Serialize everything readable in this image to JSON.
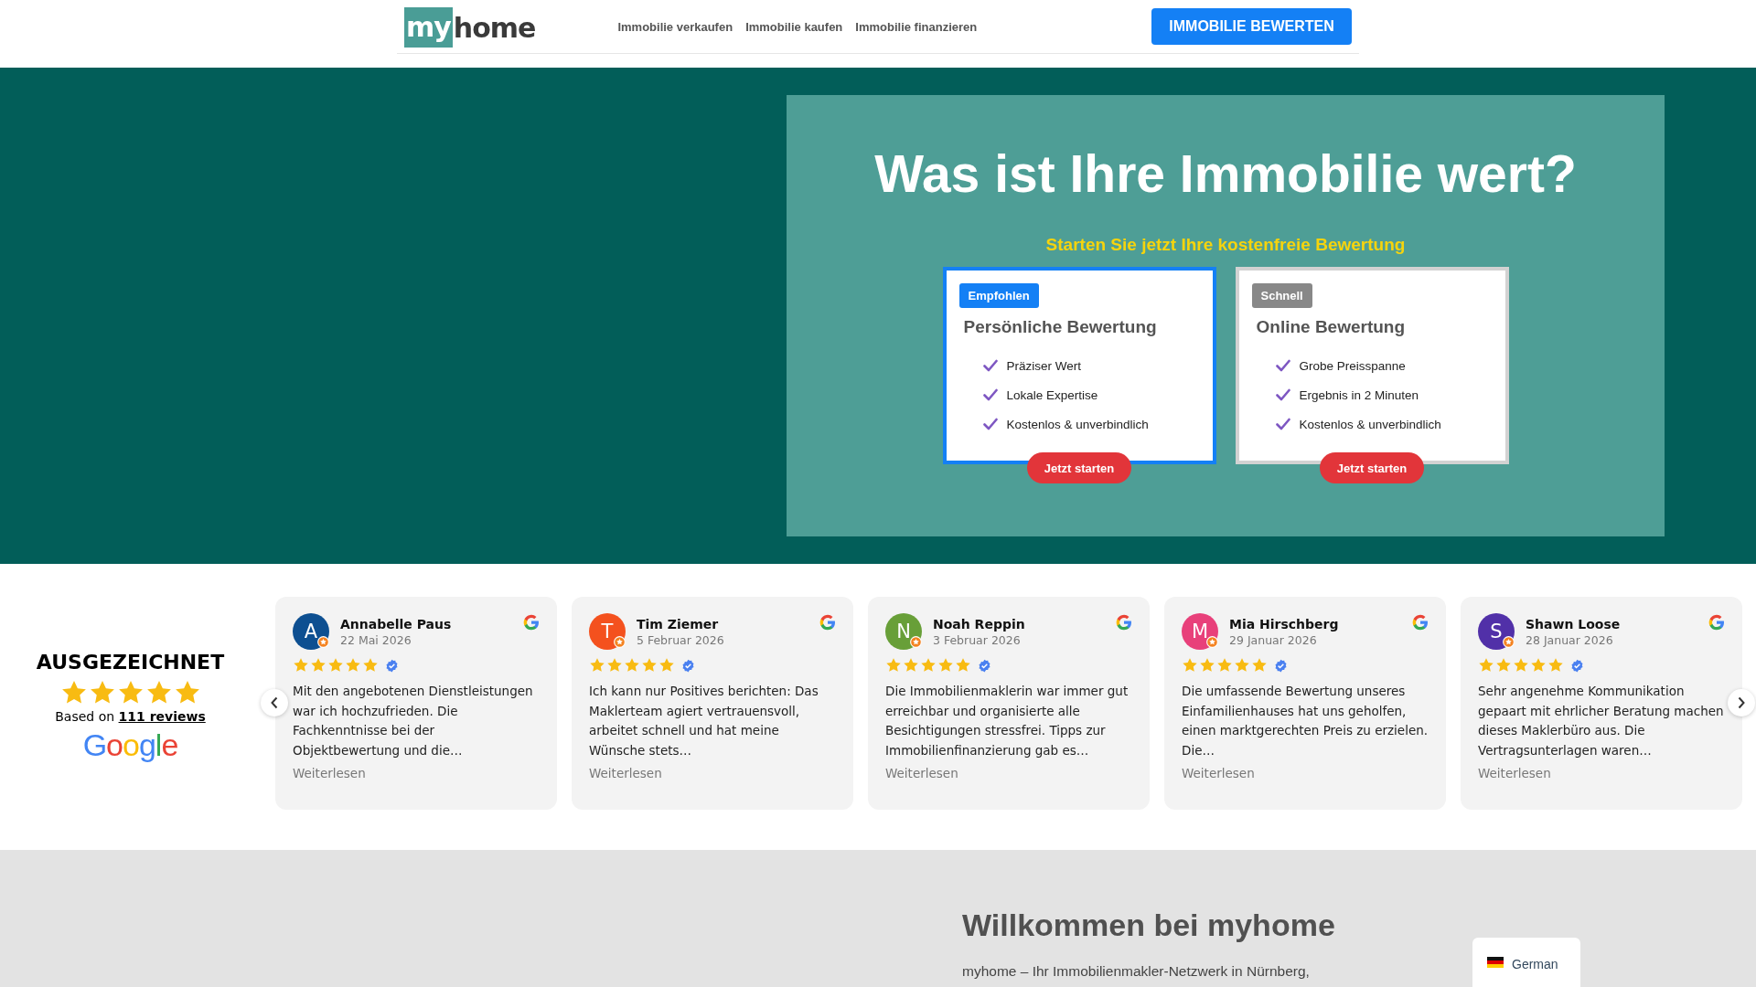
{
  "header": {
    "logo": {
      "boxed": "my",
      "rest": "home"
    },
    "nav": [
      "Immobilie verkaufen",
      "Immobilie kaufen",
      "Immobilie finanzieren"
    ],
    "cta": "IMMOBILIE BEWERTEN"
  },
  "hero": {
    "title": "Was ist Ihre Immobilie wert?",
    "subtitle": "Starten Sie jetzt Ihre kostenfreie Bewertung",
    "options": [
      {
        "badge": "Empfohlen",
        "featured": true,
        "title": "Persönliche Bewertung",
        "features": [
          "Präziser Wert",
          "Lokale Expertise",
          "Kostenlos & unverbindlich"
        ],
        "button": "Jetzt starten"
      },
      {
        "badge": "Schnell",
        "featured": false,
        "title": "Online Bewertung",
        "features": [
          "Grobe Preisspanne",
          "Ergebnis in 2 Minuten",
          "Kostenlos & unverbindlich"
        ],
        "button": "Jetzt starten"
      }
    ]
  },
  "reviews_summary": {
    "rating": "AUSGEZEICHNET",
    "stars": 5,
    "based_on": "Based on",
    "reviews_link": "111 reviews",
    "source": "Google"
  },
  "reviews": [
    {
      "initial": "A",
      "color": "#0d4f91",
      "name": "Annabelle Paus",
      "date": "22 Mai 2026",
      "stars": 5,
      "text": "Mit den angebotenen Dienstleistungen war ich hochzufrieden. Die Fachkenntnisse bei der Objektbewertung und die…",
      "more": "Weiterlesen"
    },
    {
      "initial": "T",
      "color": "#f4511e",
      "name": "Tim Ziemer",
      "date": "5 Februar 2026",
      "stars": 5,
      "text": "Ich kann nur Positives berichten: Das Maklerteam agiert vertrauensvoll, arbeitet schnell und hat meine Wünsche stets…",
      "more": "Weiterlesen"
    },
    {
      "initial": "N",
      "color": "#689f38",
      "name": "Noah Reppin",
      "date": "3 Februar 2026",
      "stars": 5,
      "text": "Die Immobilienmaklerin war immer gut erreichbar und organisierte alle Besichtigungen stressfrei. Tipps zur Immobilienfinanzierung gab es…",
      "more": "Weiterlesen"
    },
    {
      "initial": "M",
      "color": "#e8407a",
      "name": "Mia Hirschberg",
      "date": "29 Januar 2026",
      "stars": 5,
      "text": "Die umfassende Bewertung unseres Einfamilienhauses hat uns geholfen, einen marktgerechten Preis zu erzielen. Die…",
      "more": "Weiterlesen"
    },
    {
      "initial": "S",
      "color": "#5130a8",
      "name": "Shawn Loose",
      "date": "28 Januar 2026",
      "stars": 5,
      "text": "Sehr angenehme Kommunikation gepaart mit ehrlicher Beratung machen dieses Maklerbüro aus. Die Vertragsunterlagen waren…",
      "more": "Weiterlesen"
    }
  ],
  "welcome": {
    "title": "Willkommen bei myhome",
    "text": "myhome – Ihr Immobilienmakler-Netzwerk in Nürnberg,"
  },
  "language": {
    "label": "German"
  }
}
